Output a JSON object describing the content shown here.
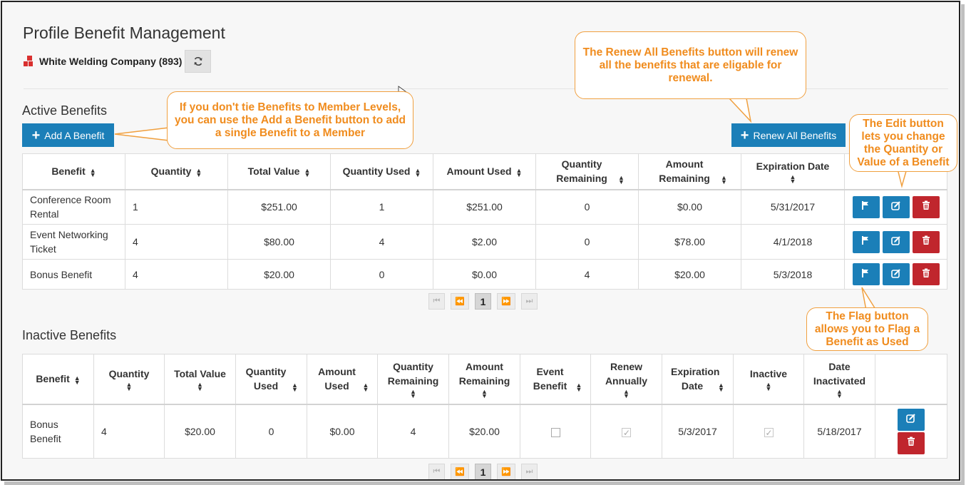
{
  "page_title": "Profile Benefit Management",
  "company": {
    "name": "White Welding Company (893)",
    "icon": "building-icon"
  },
  "active": {
    "title": "Active Benefits",
    "add_button": "Add A Benefit",
    "renew_button": "Renew All Benefits",
    "headers": [
      {
        "label": "Benefit",
        "stack": false
      },
      {
        "label": "Quantity",
        "stack": false
      },
      {
        "label": "Total Value",
        "stack": false
      },
      {
        "label": "Quantity Used",
        "stack": false
      },
      {
        "label": "Amount Used",
        "stack": false
      },
      {
        "label": "Quantity Remaining",
        "stack": false
      },
      {
        "label": "Amount Remaining",
        "stack": false
      },
      {
        "label": "Expiration Date",
        "stack": true
      }
    ],
    "rows": [
      [
        "Conference Room Rental",
        "1",
        "$251.00",
        "1",
        "$251.00",
        "0",
        "$0.00",
        "5/31/2017"
      ],
      [
        "Event Networking Ticket",
        "4",
        "$80.00",
        "4",
        "$2.00",
        "0",
        "$78.00",
        "4/1/2018"
      ],
      [
        "Bonus Benefit",
        "4",
        "$20.00",
        "0",
        "$0.00",
        "4",
        "$20.00",
        "5/3/2018"
      ]
    ],
    "page": "1"
  },
  "inactive": {
    "title": "Inactive Benefits",
    "headers": [
      "Benefit",
      "Quantity",
      "Total Value",
      "Quantity Used",
      "Amount Used",
      "Quantity Remaining",
      "Amount Remaining",
      "Event Benefit",
      "Renew Annually",
      "Expiration Date",
      "Inactive",
      "Date Inactivated"
    ],
    "rows": [
      {
        "benefit": "Bonus Benefit",
        "quantity": "4",
        "total_value": "$20.00",
        "quantity_used": "0",
        "amount_used": "$0.00",
        "quantity_remaining": "4",
        "amount_remaining": "$20.00",
        "event_benefit": false,
        "renew_annually": true,
        "expiration_date": "5/3/2017",
        "inactive": true,
        "date_inactivated": "5/18/2017"
      }
    ],
    "page": "1"
  },
  "callouts": {
    "add": "If you don't tie Benefits to Member Levels, you can use the Add a Benefit button to add a single Benefit to a Member",
    "renew": "The Renew All Benefits button will renew all the benefits that are eligable for renewal.",
    "edit": "The Edit button lets you change the Quantity or Value of a Benefit",
    "flag": "The Flag button allows you to Flag a Benefit as Used"
  },
  "colors": {
    "primary": "#1b7fb8",
    "danger": "#c0262d",
    "callout": "#f08c1e"
  }
}
